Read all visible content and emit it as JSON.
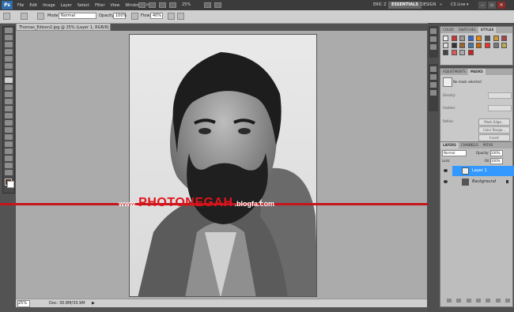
{
  "menubar": {
    "app_logo": "Ps",
    "items": [
      "File",
      "Edit",
      "Image",
      "Layer",
      "Select",
      "Filter",
      "View",
      "Window",
      "Help"
    ],
    "zoom": "25%",
    "workspaces": [
      "ERIC Z",
      "ESSENTIALS",
      "DESIGN"
    ],
    "overflow": "»",
    "cs_live": "CS Live ▾",
    "window_buttons": [
      "–",
      "▫",
      "✕"
    ]
  },
  "options": {
    "mode_label": "Mode:",
    "mode_value": "Normal",
    "opacity_label": "Opacity:",
    "opacity_value": "100%",
    "flow_label": "Flow:",
    "flow_value": "40%"
  },
  "document": {
    "tab_title": "Thomas_Edison2.jpg @ 25% (Layer 1, RGB/8)",
    "status_zoom": "25%",
    "status_doc": "Doc: 30.8M/33.9M"
  },
  "watermark": {
    "prefix": "www.",
    "brand": "PHOTONEGAH",
    "suffix": ".blogfa.com"
  },
  "panels": {
    "swatches_tabs": [
      "COLOR",
      "SWATCHES",
      "STYLES"
    ],
    "adjustments_tabs": [
      "ADJUSTMENTS",
      "MASKS"
    ],
    "masks_status": "No mask selected",
    "masks_fields": [
      "Density:",
      "Feather:",
      "Refine:"
    ],
    "masks_buttons": [
      "Mask Edge...",
      "Color Range...",
      "Invert"
    ],
    "layers_tabs": [
      "LAYERS",
      "CHANNELS",
      "PATHS"
    ],
    "blend_mode": "Normal",
    "layers_opacity_label": "Opacity:",
    "layers_opacity": "100%",
    "lock_label": "Lock:",
    "fill_label": "Fill:",
    "fill_value": "100%",
    "layers": [
      {
        "name": "Layer 1",
        "selected": true
      },
      {
        "name": "Background",
        "selected": false
      }
    ]
  },
  "colors": {
    "foreground": "#4a3324",
    "background": "#ffffff",
    "selection": "#3399ff",
    "watermark_red": "#c4161c"
  }
}
